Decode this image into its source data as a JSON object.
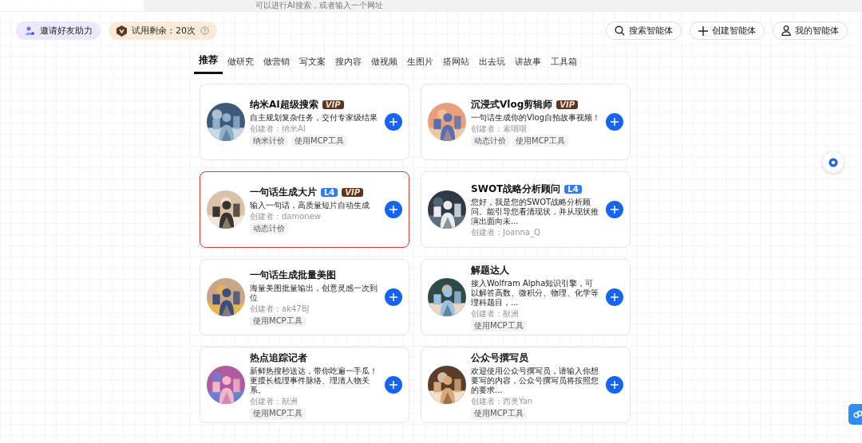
{
  "address_bar": {
    "placeholder": "可以进行AI搜索，或者输入一个网址"
  },
  "top_left": [
    {
      "kind": "invite",
      "label": "邀请好友助力"
    },
    {
      "kind": "trial",
      "label": "试用剩余：20次"
    }
  ],
  "top_right": [
    {
      "kind": "search",
      "label": "搜索智能体"
    },
    {
      "kind": "create",
      "label": "创建智能体"
    },
    {
      "kind": "mine",
      "label": "我的智能体"
    }
  ],
  "tabs": [
    {
      "label": "推荐",
      "selected": true
    },
    {
      "label": "做研究",
      "selected": false
    },
    {
      "label": "做营销",
      "selected": false
    },
    {
      "label": "写文案",
      "selected": false
    },
    {
      "label": "搜内容",
      "selected": false
    },
    {
      "label": "做视频",
      "selected": false
    },
    {
      "label": "生图片",
      "selected": false
    },
    {
      "label": "搭网站",
      "selected": false
    },
    {
      "label": "出去玩",
      "selected": false
    },
    {
      "label": "讲故事",
      "selected": false
    },
    {
      "label": "工具箱",
      "selected": false
    }
  ],
  "agents": [
    {
      "title": "纳米AI超级搜索",
      "badges": [
        {
          "kind": "vip",
          "text": "VIP"
        }
      ],
      "description": "自主规划复杂任务，交付专家级结果",
      "creator": "创建者：纳米AI",
      "tags": [
        "纳米计价",
        "使用MCP工具"
      ],
      "highlighted": false
    },
    {
      "title": "沉浸式Vlog剪辑师",
      "badges": [
        {
          "kind": "vip",
          "text": "VIP"
        }
      ],
      "description": "一句话生成你的Vlog自拍故事视频！",
      "creator": "创建者：素咽咽",
      "tags": [
        "动态计价",
        "使用MCP工具"
      ],
      "highlighted": false
    },
    {
      "title": "一句话生成大片",
      "badges": [
        {
          "kind": "level",
          "text": "L4"
        },
        {
          "kind": "vip",
          "text": "VIP"
        }
      ],
      "description": "输入一句话，高质量短片自动生成",
      "creator": "创建者：damonew",
      "tags": [
        "动态计价"
      ],
      "highlighted": true
    },
    {
      "title": "SWOT战略分析顾问",
      "badges": [
        {
          "kind": "level",
          "text": "L4"
        }
      ],
      "description": "您好，我是您的SWOT战略分析顾问。能引导您看清现状，并从现状推演出面向未...",
      "creator": "创建者：Joanna_Q",
      "highlighted": false
    },
    {
      "title": "一句话生成批量美图",
      "description": "海量美图批量输出，创意灵感一次到位",
      "creator": "创建者：ak47BJ",
      "tags": [
        "使用MCP工具"
      ],
      "highlighted": false
    },
    {
      "title": "解题达人",
      "description": "接入Wolfram Alpha知识引擎，可以解答高数、微积分、物理、化学等理科题目，...",
      "creator": "创建者：猷洲",
      "tags": [
        "使用MCP工具"
      ],
      "highlighted": false
    },
    {
      "title": "热点追踪记者",
      "description": "新鲜热搜秒送达，带你吃遍一手瓜！更擅长梳理事件脉络、理清人物关系。",
      "creator": "创建者：猷洲",
      "tags": [
        "使用MCP工具"
      ],
      "highlighted": false
    },
    {
      "title": "公众号撰写员",
      "description": "欢迎使用公众号撰写员，请输入你想要写的内容，公众号撰写员将按照您的要求...",
      "creator": "创建者：西奥Yan",
      "tags": [
        "使用MCP工具"
      ],
      "highlighted": false
    }
  ]
}
